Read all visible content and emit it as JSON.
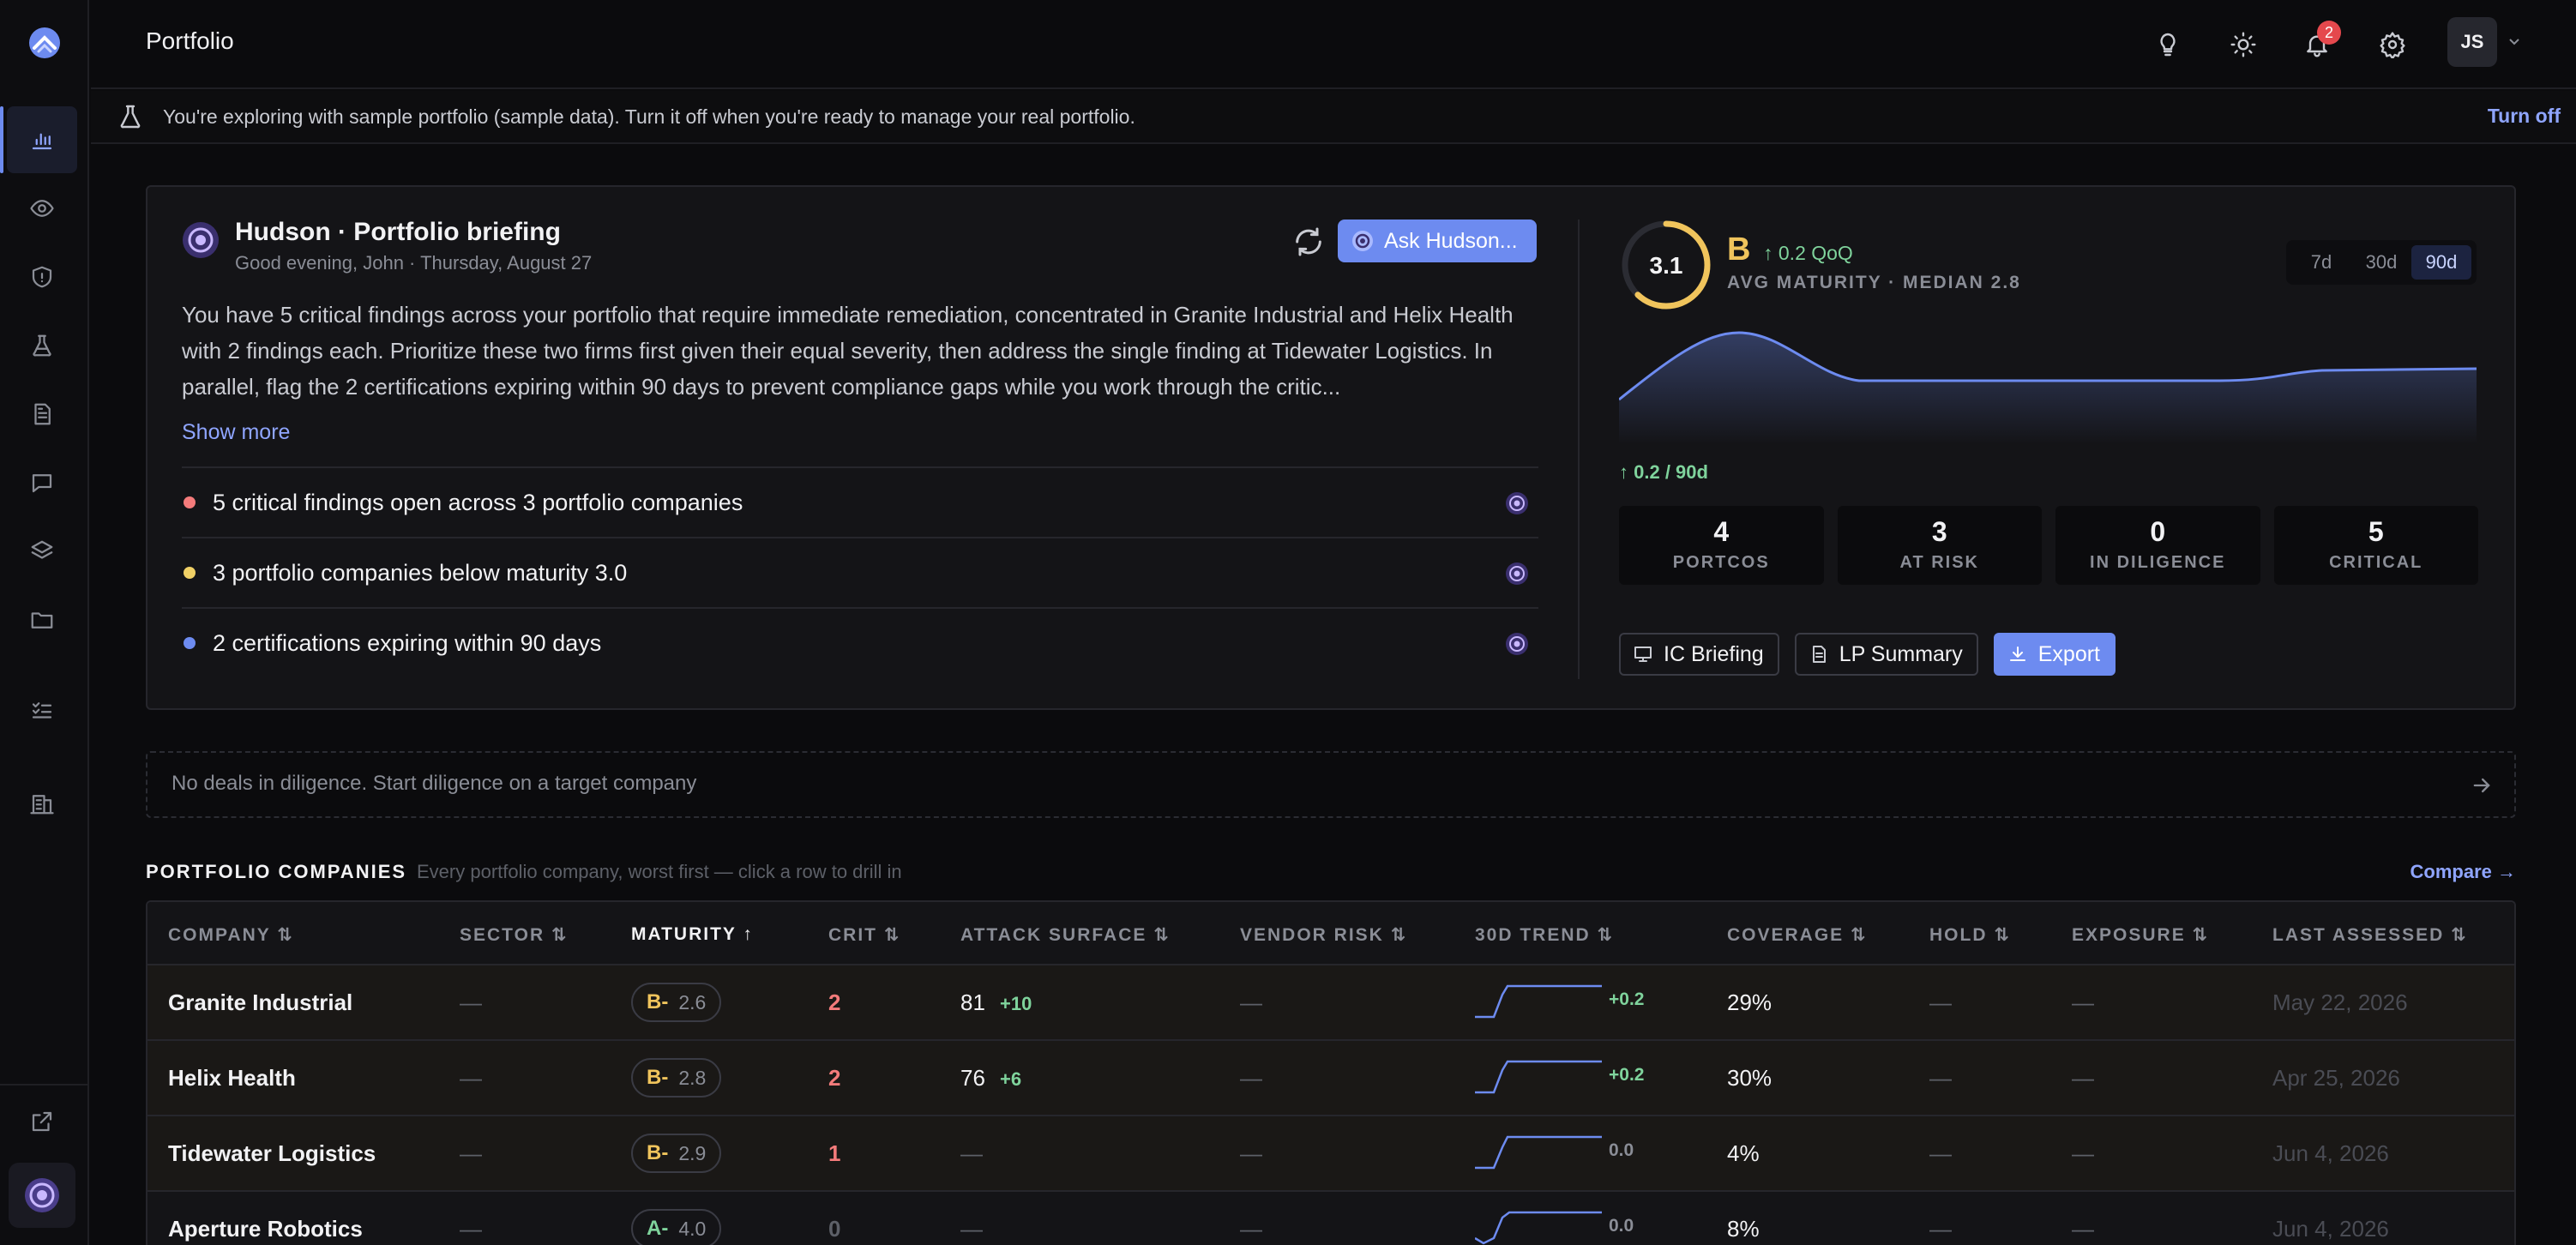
{
  "app": {
    "title": "Portfolio"
  },
  "topbar": {
    "notifications_count": "2",
    "avatar_initials": "JS"
  },
  "banner": {
    "text": "You're exploring with sample portfolio (sample data). Turn it off when you're ready to manage your real portfolio.",
    "action": "Turn off"
  },
  "briefing": {
    "title": "Hudson · Portfolio briefing",
    "subtitle": "Good evening, John · Thursday, August 27",
    "ask_button": "Ask Hudson...",
    "body": "You have 5 critical findings across your portfolio that require immediate remediation, concentrated in Granite Industrial and Helix Health with 2 findings each. Prioritize these two firms first given their equal severity, then address the single finding at Tidewater Logistics. In parallel, flag the 2 certifications expiring within 90 days to prevent compliance gaps while you work through the critic...",
    "show_more": "Show more",
    "findings": [
      {
        "text": "5 critical findings open across 3 portfolio companies",
        "color": "#f47b7b"
      },
      {
        "text": "3 portfolio companies below maturity 3.0",
        "color": "#f0d066"
      },
      {
        "text": "2 certifications expiring within 90 days",
        "color": "#6d8bf0"
      }
    ]
  },
  "maturity": {
    "score": "3.1",
    "score_fraction": 0.62,
    "grade": "B",
    "qoq": "0.2 QoQ",
    "avg_label": "AVG MATURITY · MEDIAN 2.8",
    "ranges": [
      "7d",
      "30d",
      "90d"
    ],
    "selected_range": "90d",
    "delta": "0.2 / 90d",
    "stats": [
      {
        "value": "4",
        "label": "PORTCOS"
      },
      {
        "value": "3",
        "label": "AT RISK"
      },
      {
        "value": "0",
        "label": "IN DILIGENCE"
      },
      {
        "value": "5",
        "label": "CRITICAL"
      }
    ],
    "actions": {
      "ic": "IC Briefing",
      "lp": "LP Summary",
      "export": "Export"
    }
  },
  "diligence": {
    "text": "No deals in diligence. Start diligence on a target company"
  },
  "companies": {
    "title": "PORTFOLIO COMPANIES",
    "subtitle": "Every portfolio company, worst first — click a row to drill in",
    "compare": "Compare →",
    "columns": [
      "COMPANY",
      "SECTOR",
      "MATURITY",
      "CRIT",
      "ATTACK SURFACE",
      "VENDOR RISK",
      "30D TREND",
      "COVERAGE",
      "HOLD",
      "EXPOSURE",
      "LAST ASSESSED"
    ],
    "rows": [
      {
        "name": "Granite Industrial",
        "sector": "—",
        "grade": "B-",
        "grade_color": "#f0c45c",
        "maturity": "2.6",
        "crit": "2",
        "attack": "81",
        "attack_delta": "+10",
        "vendor": "—",
        "trend_delta": "+0.2",
        "coverage": "29%",
        "hold": "—",
        "exposure": "—",
        "assessed": "May 22, 2026"
      },
      {
        "name": "Helix Health",
        "sector": "—",
        "grade": "B-",
        "grade_color": "#f0c45c",
        "maturity": "2.8",
        "crit": "2",
        "attack": "76",
        "attack_delta": "+6",
        "vendor": "—",
        "trend_delta": "+0.2",
        "coverage": "30%",
        "hold": "—",
        "exposure": "—",
        "assessed": "Apr 25, 2026"
      },
      {
        "name": "Tidewater Logistics",
        "sector": "—",
        "grade": "B-",
        "grade_color": "#f0c45c",
        "maturity": "2.9",
        "crit": "1",
        "attack": "—",
        "attack_delta": "",
        "vendor": "—",
        "trend_delta": "0.0",
        "coverage": "4%",
        "hold": "—",
        "exposure": "—",
        "assessed": "Jun 4, 2026"
      },
      {
        "name": "Aperture Robotics",
        "sector": "—",
        "grade": "A-",
        "grade_color": "#7fd39c",
        "maturity": "4.0",
        "crit": "0",
        "attack": "—",
        "attack_delta": "",
        "vendor": "—",
        "trend_delta": "0.0",
        "coverage": "8%",
        "hold": "—",
        "exposure": "—",
        "assessed": "Jun 4, 2026"
      }
    ]
  },
  "colors": {
    "accent": "#6d8bf0",
    "critical": "#f47b7b",
    "positive": "#7fd39c",
    "grade_b": "#f0c45c"
  }
}
